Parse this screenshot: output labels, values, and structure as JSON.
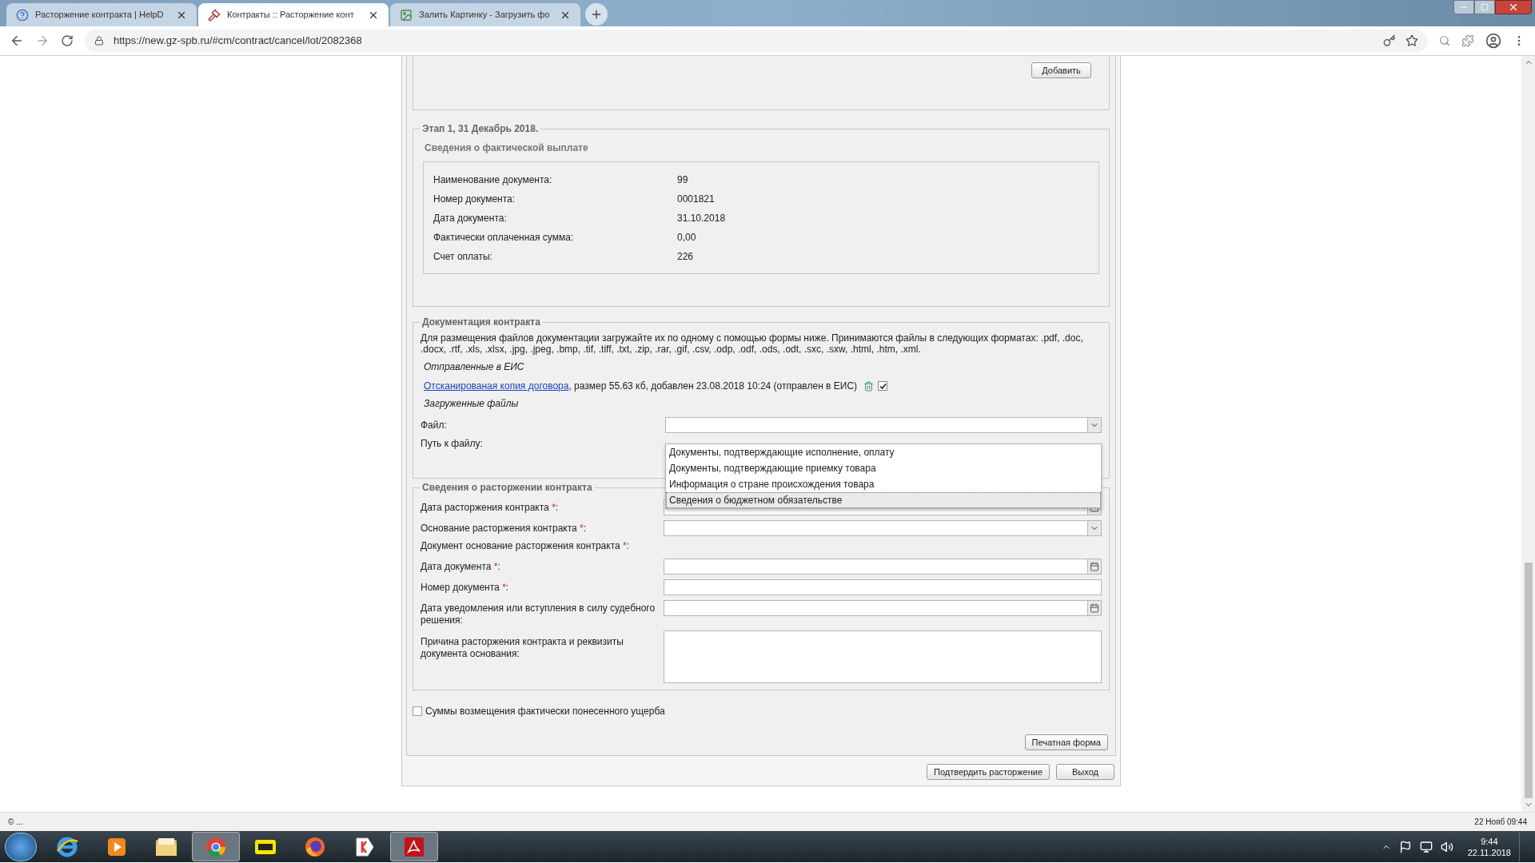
{
  "browser": {
    "tabs": [
      {
        "title": "Расторжение контракта | HelpD",
        "selected": false
      },
      {
        "title": "Контракты :: Расторжение конт",
        "selected": true
      },
      {
        "title": "Залить Картинку - Загрузить фо",
        "selected": false
      }
    ],
    "url": "https://new.gz-spb.ru/#cm/contract/cancel/lot/2082368"
  },
  "page": {
    "add_button": "Добавить",
    "stage": {
      "legend": "Этап 1, 31 Декабрь 2018.",
      "subtitle": "Сведения о фактической выплате",
      "rows": [
        {
          "label": "Наименование документа:",
          "value": "99"
        },
        {
          "label": "Номер документа:",
          "value": "0001821"
        },
        {
          "label": "Дата документа:",
          "value": "31.10.2018"
        },
        {
          "label": "Фактически оплаченная сумма:",
          "value": "0,00"
        },
        {
          "label": "Счет оплаты:",
          "value": "226"
        }
      ]
    },
    "documentation": {
      "legend": "Документация контракта",
      "text": "Для размещения файлов документации загружайте их по одному с помощью формы ниже. Принимаются файлы в следующих форматах: .pdf, .doc, .docx, .rtf, .xls, .xlsx, .jpg, .jpeg, .bmp, .tif, .tiff, .txt, .zip, .rar, .gif, .csv, .odp, .odf, .ods, .odt, .sxc, .sxw, .html, .htm, .xml.",
      "sent_heading": "Отправленные в ЕИС",
      "file": {
        "link": "Отсканированая копия договора",
        "details": ", размер 55.63 кб, добавлен 23.08.2018 10:24 (отправлен в ЕИС)",
        "checked": true
      },
      "uploaded_heading": "Загруженные файлы",
      "file_label": "Файл:",
      "path_label": "Путь к файлу:",
      "dropdown_options": [
        {
          "label": "Документы, подтверждающие исполнение, оплату",
          "selected": false
        },
        {
          "label": "Документы, подтверждающие приемку товара",
          "selected": false
        },
        {
          "label": "Информация о стране происхождения товара",
          "selected": false
        },
        {
          "label": "Сведения о бюджетном обязательстве",
          "selected": true
        }
      ]
    },
    "termination": {
      "legend": "Сведения о расторжении контракта",
      "fields": [
        {
          "kind": "date",
          "label": "Дата расторжения контракта",
          "required_mark": "*",
          "suffix": ":"
        },
        {
          "kind": "select",
          "label": "Основание расторжения контракта",
          "required_mark": "*",
          "suffix": ":"
        },
        {
          "kind": "heading",
          "label": "Документ основание расторжения контракта",
          "required_mark": "*",
          "suffix": ":"
        },
        {
          "kind": "date",
          "label": "Дата документа",
          "required_mark": "*",
          "suffix": ":"
        },
        {
          "kind": "text",
          "label": "Номер документа",
          "required_mark": "*",
          "suffix": ":"
        },
        {
          "kind": "date",
          "label": "Дата уведомления или вступления в силу судебного решения:"
        },
        {
          "kind": "textarea",
          "label": "Причина расторжения контракта и реквизиты документа основания:"
        }
      ]
    },
    "damages": {
      "label": "Суммы возмещения фактически понесенного ущерба",
      "checked": false
    },
    "print_button": "Печатная форма",
    "buttons": [
      "Подтвердить расторжение",
      "Выход"
    ]
  },
  "status_bar": {
    "left": "© ...",
    "right": "22 Нояб 09:44"
  },
  "taskbar": {
    "apps": [
      {
        "kind": "ie",
        "selected": false
      },
      {
        "kind": "media",
        "selected": false
      },
      {
        "kind": "folder",
        "selected": false
      },
      {
        "kind": "chrome",
        "selected": true
      },
      {
        "kind": "pdf",
        "selected": false
      },
      {
        "kind": "firefox",
        "selected": false
      },
      {
        "kind": "yandex",
        "selected": false
      },
      {
        "kind": "acrobat",
        "selected": true
      }
    ],
    "time": "9:44",
    "date": "22.11.2018"
  }
}
